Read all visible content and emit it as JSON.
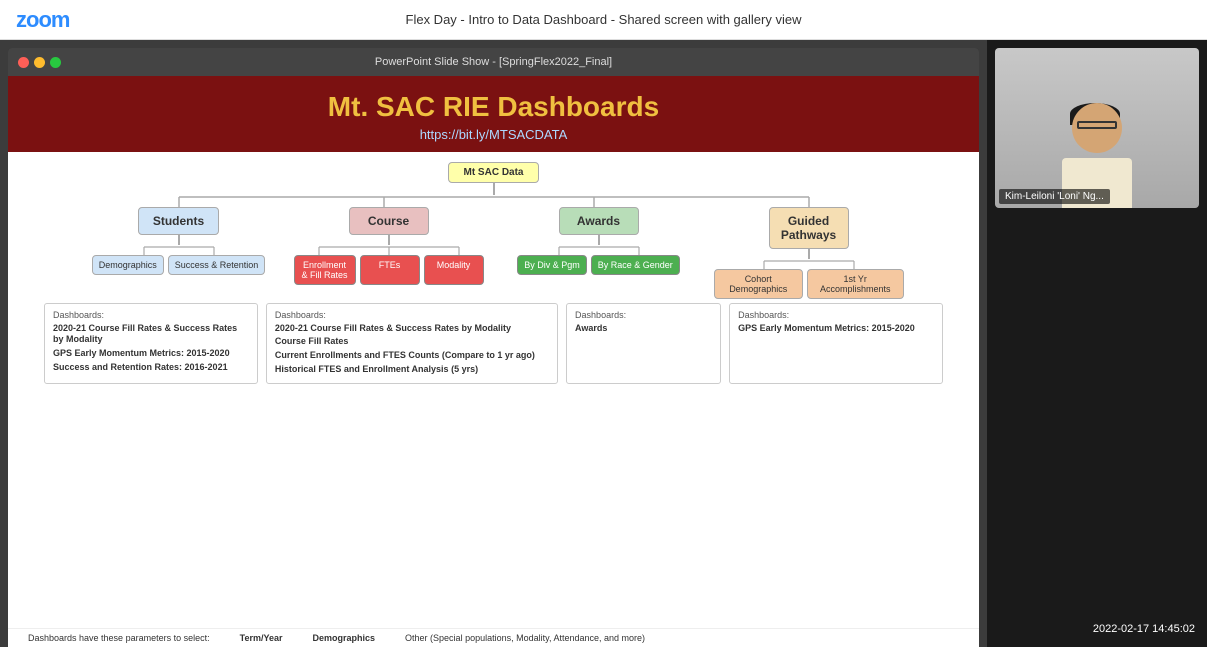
{
  "topbar": {
    "logo": "zoom",
    "title": "Flex Day - Intro to Data Dashboard - Shared screen with gallery view"
  },
  "ppt": {
    "titlebar": "PowerPoint Slide Show - [SpringFlex2022_Final]",
    "slide": {
      "title": "Mt. SAC RIE Dashboards",
      "url": "https://bit.ly/MTSACDATA",
      "root_node": "Mt SAC Data",
      "level1": [
        {
          "label": "Students",
          "color": "blue"
        },
        {
          "label": "Course",
          "color": "red"
        },
        {
          "label": "Awards",
          "color": "green"
        },
        {
          "label": "Guided\nPathways",
          "color": "tan"
        }
      ],
      "level2": {
        "students": [
          "Demographics",
          "Success &\nRetention"
        ],
        "course": [
          "Enrollment & Fill\nRates",
          "FTEs",
          "Modality"
        ],
        "awards": [
          "By Div & Pgm",
          "By Race &\nGender"
        ],
        "gp": [
          "Cohort\nDemographics",
          "1st Yr\nAccomplishments"
        ]
      },
      "info_boxes": [
        {
          "id": "box1",
          "label": "Dashboards:",
          "items": [
            "2020-21 Course Fill Rates &\nSuccess Rates by Modality",
            "GPS Early Momentum Metrics:\n2015-2020",
            "Success and Retention Rates:\n2016-2021"
          ]
        },
        {
          "id": "box2",
          "label": "Dashboards:",
          "items": [
            "2020-21 Course Fill Rates &\nSuccess Rates by Modality",
            "Course Fill Rates",
            "Current Enrollments and FTES\nCounts (Compare to 1 yr ago)",
            "Historical FTES and Enrollment\nAnalysis (5 yrs)"
          ]
        },
        {
          "id": "box3",
          "label": "Dashboards:",
          "items": [
            "Awards"
          ]
        },
        {
          "id": "box4",
          "label": "Dashboards:",
          "items": [
            "GPS Early Momentum\nMetrics: 2015-2020"
          ]
        }
      ],
      "params": {
        "intro": "Dashboards have these parameters to select:",
        "term_label": "Term/Year",
        "demo_label": "Demographics",
        "other_label": "Other",
        "other_desc": "(Special populations, Modality, Attendance, and more)"
      }
    }
  },
  "gallery": {
    "participant": {
      "name": "Kim-Leiloni 'Loni' Ng..."
    },
    "timestamp": "2022-02-17  14:45:02"
  }
}
